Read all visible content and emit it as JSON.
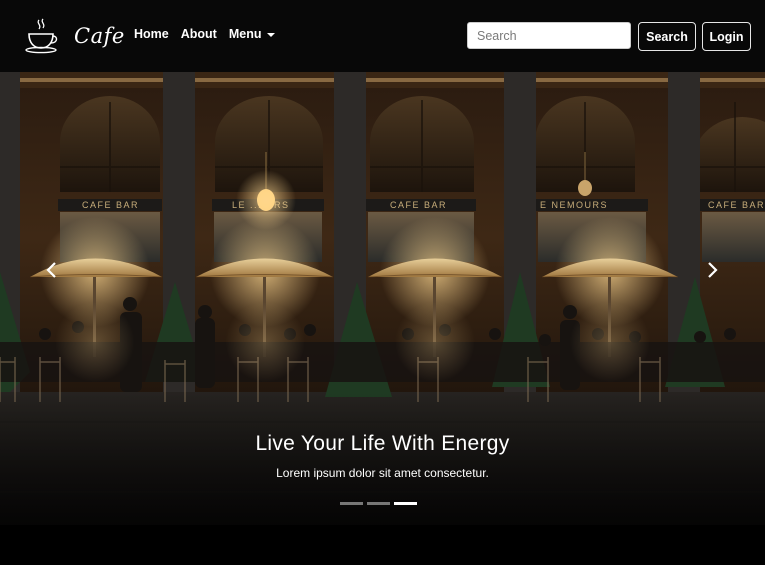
{
  "brand": {
    "name": "Cafe",
    "icon": "coffee-cup-icon"
  },
  "nav": {
    "links": [
      {
        "label": "Home"
      },
      {
        "label": "About"
      },
      {
        "label": "Menu"
      }
    ]
  },
  "search": {
    "placeholder": "Search",
    "button_label": "Search"
  },
  "login": {
    "label": "Login"
  },
  "carousel": {
    "title": "Live Your Life With Energy",
    "subtitle": "Lorem ipsum dolor sit amet consectetur.",
    "slide_count": 3,
    "active_index": 2
  },
  "scene_signs": [
    "CAFE BAR",
    "LE ... URS",
    "CAFE BAR",
    "E NEMOURS",
    "CAFE BAR"
  ],
  "colors": {
    "navbar": "#080808",
    "text": "#ffffff",
    "lamp": "#ffd27a"
  }
}
